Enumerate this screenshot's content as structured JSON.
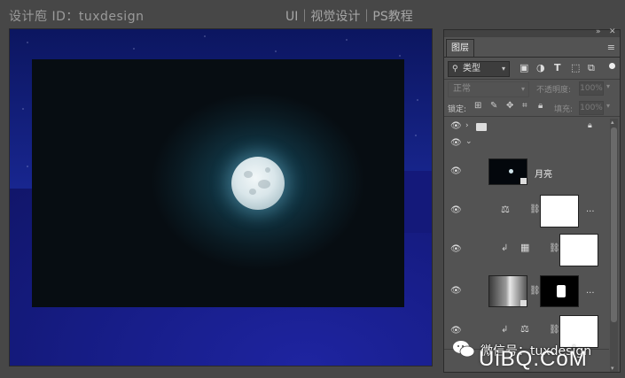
{
  "watermark": {
    "left": "设计庖 ID：tuxdesign",
    "right": "UI｜视觉设计｜PS教程"
  },
  "panel": {
    "tab_label": "图层",
    "filter": {
      "value": "类型",
      "icon": "search-icon"
    },
    "filter_icons": [
      "image-filter-icon",
      "adjustment-filter-icon",
      "type-filter-icon",
      "shape-filter-icon",
      "smart-object-filter-icon"
    ],
    "blend_mode": "正常",
    "opacity_label": "不透明度:",
    "opacity_value": "100%",
    "lock_label": "锁定:",
    "lock_icons": [
      "lock-transparent-icon",
      "lock-image-icon",
      "lock-position-icon",
      "lock-artboard-icon",
      "lock-all-icon"
    ],
    "fill_label": "填充:",
    "fill_value": "100%"
  },
  "layers": [
    {
      "type": "group",
      "name": "",
      "expanded": false,
      "locked": true
    },
    {
      "type": "group",
      "name": "",
      "expanded": true
    },
    {
      "type": "layer",
      "name": "月亮"
    },
    {
      "type": "adjustment",
      "adjustment": "balance-icon",
      "trailing": "..."
    },
    {
      "type": "adjustment",
      "adjustment": "curves-icon",
      "clipped": true
    },
    {
      "type": "layer",
      "trailing": "..."
    },
    {
      "type": "adjustment",
      "adjustment": "balance-icon",
      "clipped": true
    }
  ],
  "brand": {
    "wechat_text": "微信号：tuxdesign",
    "site": "UiBQ.CoM"
  },
  "colors": {
    "canvas_sky": "#1b2a9c",
    "panel_bg": "#535353",
    "app_bg": "#474747"
  }
}
